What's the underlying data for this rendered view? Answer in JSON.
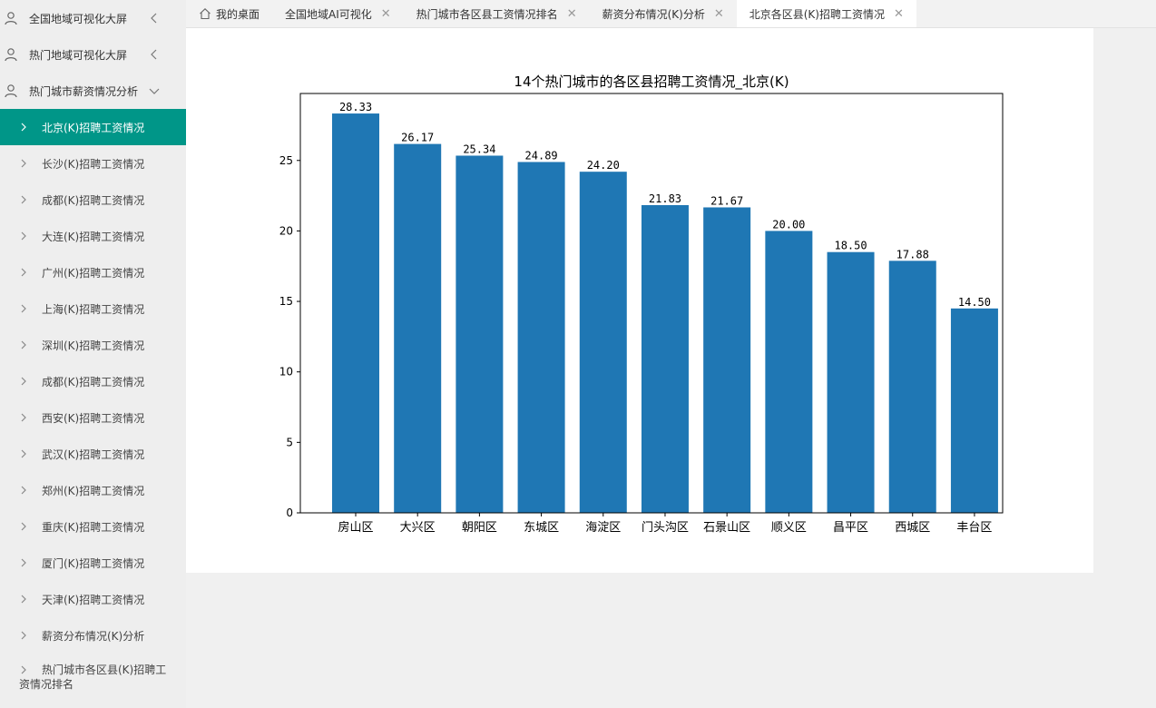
{
  "sidebar": {
    "menus": [
      {
        "label": "全国地域可视化大屏",
        "expanded": false
      },
      {
        "label": "热门地域可视化大屏",
        "expanded": false
      },
      {
        "label": "热门城市薪资情况分析",
        "expanded": true
      }
    ],
    "sub_items": [
      {
        "label": "北京(K)招聘工资情况",
        "active": true
      },
      {
        "label": "长沙(K)招聘工资情况"
      },
      {
        "label": "成都(K)招聘工资情况"
      },
      {
        "label": "大连(K)招聘工资情况"
      },
      {
        "label": "广州(K)招聘工资情况"
      },
      {
        "label": "上海(K)招聘工资情况"
      },
      {
        "label": "深圳(K)招聘工资情况"
      },
      {
        "label": "成都(K)招聘工资情况"
      },
      {
        "label": "西安(K)招聘工资情况"
      },
      {
        "label": "武汉(K)招聘工资情况"
      },
      {
        "label": "郑州(K)招聘工资情况"
      },
      {
        "label": "重庆(K)招聘工资情况"
      },
      {
        "label": "厦门(K)招聘工资情况"
      },
      {
        "label": "天津(K)招聘工资情况"
      },
      {
        "label": "薪资分布情况(K)分析"
      },
      {
        "label": "热门城市各区县(K)招聘工资情况排名"
      }
    ]
  },
  "tabs": [
    {
      "label": "我的桌面",
      "icon": "home-icon",
      "closable": false
    },
    {
      "label": "全国地域AI可视化",
      "closable": true
    },
    {
      "label": "热门城市各区县工资情况排名",
      "closable": true
    },
    {
      "label": "薪资分布情况(K)分析",
      "closable": true
    },
    {
      "label": "北京各区县(K)招聘工资情况",
      "closable": true,
      "active": true
    }
  ],
  "close_glyph": "✕",
  "colors": {
    "accent": "#009688",
    "bar": "#1f77b4"
  },
  "chart_data": {
    "type": "bar",
    "title": "14个热门城市的各区县招聘工资情况_北京(K)",
    "categories": [
      "房山区",
      "大兴区",
      "朝阳区",
      "东城区",
      "海淀区",
      "门头沟区",
      "石景山区",
      "顺义区",
      "昌平区",
      "西城区",
      "丰台区"
    ],
    "values": [
      28.33,
      26.17,
      25.34,
      24.89,
      24.2,
      21.83,
      21.67,
      20.0,
      18.5,
      17.88,
      14.5
    ],
    "data_labels": [
      "28.33",
      "26.17",
      "25.34",
      "24.89",
      "24.20",
      "21.83",
      "21.67",
      "20.00",
      "18.50",
      "17.88",
      "14.50"
    ],
    "yticks": [
      0,
      5,
      10,
      15,
      20,
      25
    ],
    "ylim": [
      0,
      29.75
    ],
    "xlabel": "",
    "ylabel": "",
    "grid": false
  }
}
